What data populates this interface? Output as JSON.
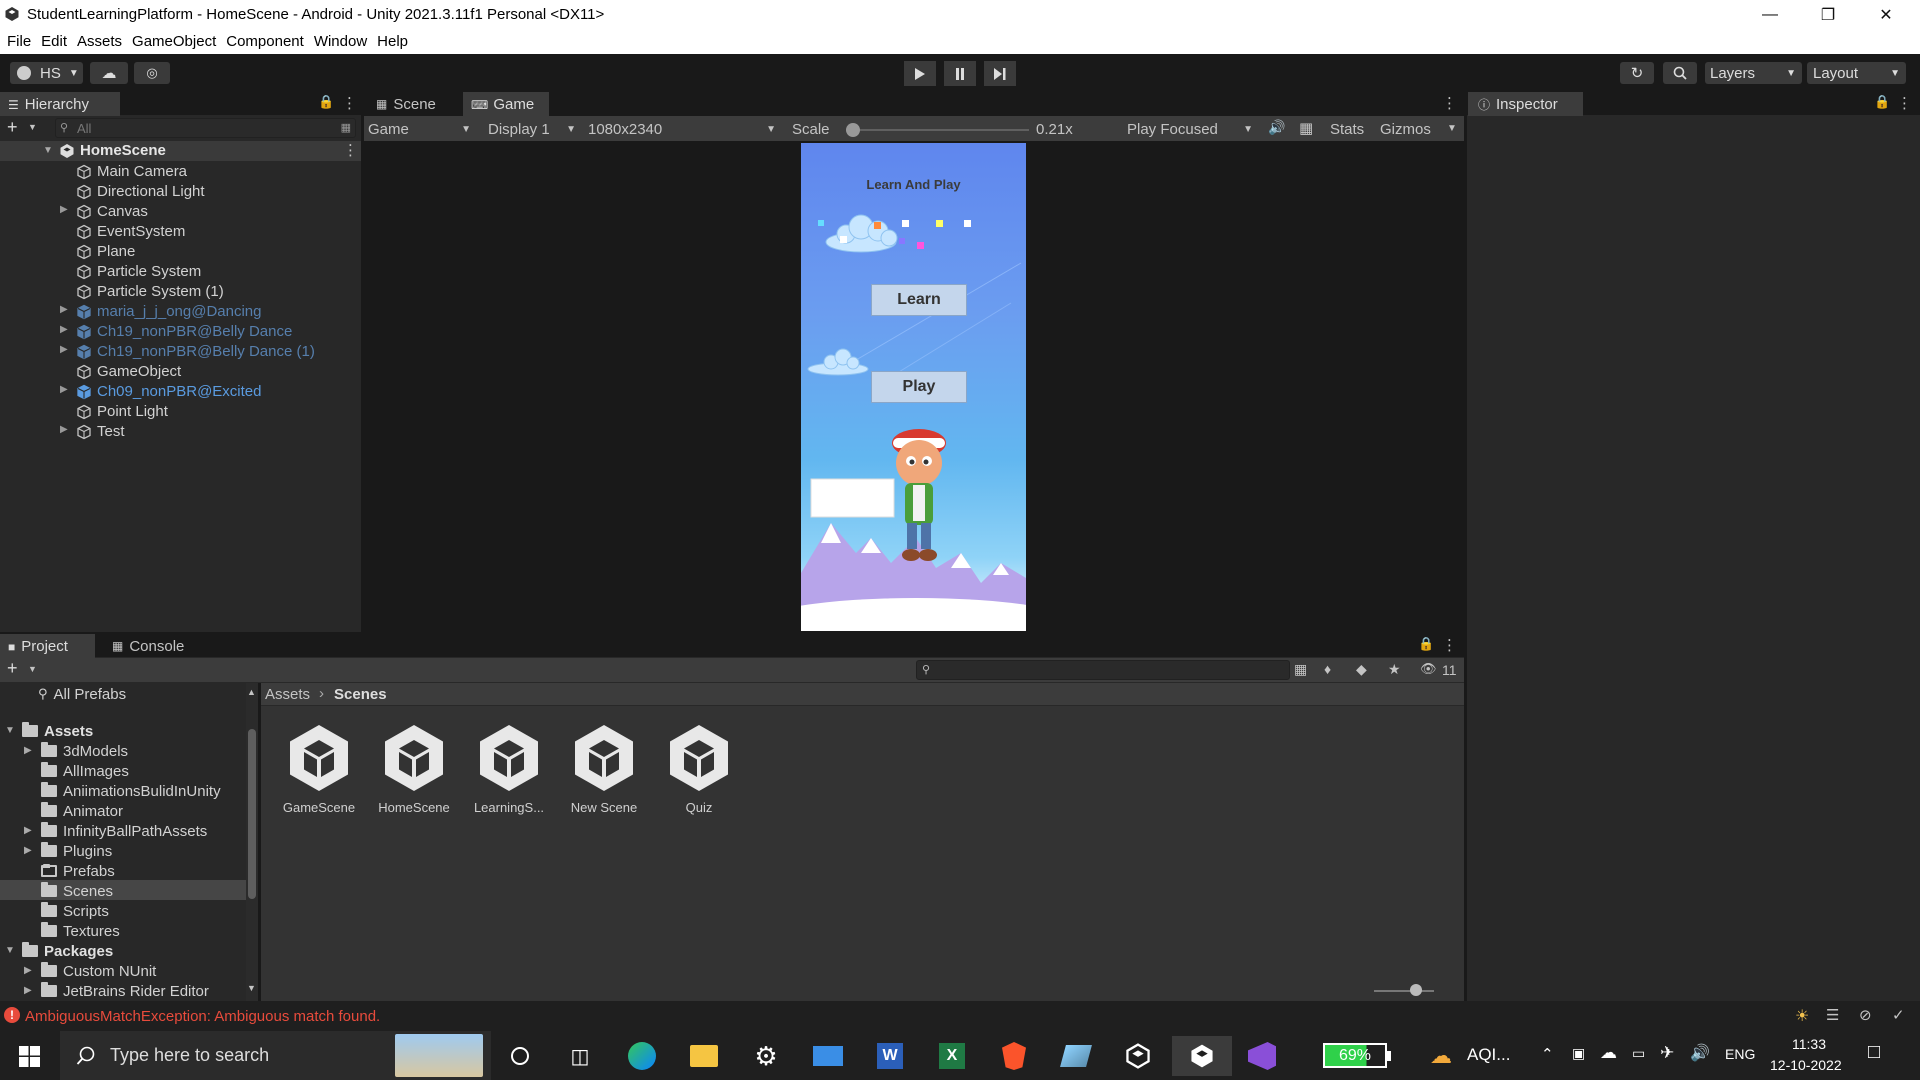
{
  "window": {
    "title": "StudentLearningPlatform - HomeScene - Android - Unity 2021.3.11f1 Personal <DX11>"
  },
  "menu": [
    "File",
    "Edit",
    "Assets",
    "GameObject",
    "Component",
    "Window",
    "Help"
  ],
  "toolbar": {
    "account_label": "HS",
    "layers_label": "Layers",
    "layout_label": "Layout"
  },
  "hierarchy": {
    "tab_label": "Hierarchy",
    "search_placeholder": "All",
    "scene_name": "HomeScene",
    "items": [
      {
        "label": "Main Camera",
        "expandable": false,
        "style": "normal"
      },
      {
        "label": "Directional Light",
        "expandable": false,
        "style": "normal"
      },
      {
        "label": "Canvas",
        "expandable": true,
        "style": "normal"
      },
      {
        "label": "EventSystem",
        "expandable": false,
        "style": "normal"
      },
      {
        "label": "Plane",
        "expandable": false,
        "style": "normal"
      },
      {
        "label": "Particle System",
        "expandable": false,
        "style": "normal"
      },
      {
        "label": "Particle System (1)",
        "expandable": false,
        "style": "normal"
      },
      {
        "label": "maria_j_j_ong@Dancing",
        "expandable": true,
        "style": "dim"
      },
      {
        "label": "Ch19_nonPBR@Belly Dance",
        "expandable": true,
        "style": "dim"
      },
      {
        "label": "Ch19_nonPBR@Belly Dance (1)",
        "expandable": true,
        "style": "dim"
      },
      {
        "label": "GameObject",
        "expandable": false,
        "style": "normal"
      },
      {
        "label": "Ch09_nonPBR@Excited",
        "expandable": true,
        "style": "blue"
      },
      {
        "label": "Point Light",
        "expandable": false,
        "style": "normal"
      },
      {
        "label": "Test",
        "expandable": true,
        "style": "normal"
      }
    ]
  },
  "game_view": {
    "tabs": [
      "Scene",
      "Game"
    ],
    "mode_dropdown": "Game",
    "display_dropdown": "Display 1",
    "resolution_dropdown": "1080x2340",
    "scale_label": "Scale",
    "scale_value": "0.21x",
    "scale_fraction": 0.0,
    "play_mode_dropdown": "Play Focused",
    "stats_label": "Stats",
    "gizmos_label": "Gizmos",
    "game_title": "Learn And Play",
    "learn_button": "Learn",
    "play_button": "Play"
  },
  "inspector": {
    "tab_label": "Inspector"
  },
  "project": {
    "tabs": [
      "Project",
      "Console"
    ],
    "hidden_count": "11",
    "favorites": "All Prefabs",
    "breadcrumb": [
      "Assets",
      "Scenes"
    ],
    "tree": [
      {
        "label": "Assets",
        "level": 0,
        "expandable": true,
        "expanded": true,
        "bold": true
      },
      {
        "label": "3dModels",
        "level": 1,
        "expandable": true
      },
      {
        "label": "AllImages",
        "level": 1,
        "expandable": false
      },
      {
        "label": "AniimationsBulidInUnity",
        "level": 1,
        "expandable": false
      },
      {
        "label": "Animator",
        "level": 1,
        "expandable": false
      },
      {
        "label": "InfinityBallPathAssets",
        "level": 1,
        "expandable": true
      },
      {
        "label": "Plugins",
        "level": 1,
        "expandable": true
      },
      {
        "label": "Prefabs",
        "level": 1,
        "expandable": false,
        "empty": true
      },
      {
        "label": "Scenes",
        "level": 1,
        "expandable": false,
        "selected": true
      },
      {
        "label": "Scripts",
        "level": 1,
        "expandable": false
      },
      {
        "label": "Textures",
        "level": 1,
        "expandable": false
      },
      {
        "label": "Packages",
        "level": 0,
        "expandable": true,
        "expanded": true,
        "bold": true
      },
      {
        "label": "Custom NUnit",
        "level": 1,
        "expandable": true
      },
      {
        "label": "JetBrains Rider Editor",
        "level": 1,
        "expandable": true
      }
    ],
    "assets": [
      "GameScene",
      "HomeScene",
      "LearningS...",
      "New Scene",
      "Quiz"
    ]
  },
  "status": {
    "error": "AmbiguousMatchException: Ambiguous match found."
  },
  "taskbar": {
    "search_placeholder": "Type here to search",
    "battery": "69%",
    "weather": "AQI...",
    "language": "ENG",
    "time": "11:33",
    "date": "12-10-2022"
  },
  "colors": {
    "accent_selection": "#2c5d87",
    "error_red": "#e84b3c",
    "battery_green": "#2fd14a"
  }
}
